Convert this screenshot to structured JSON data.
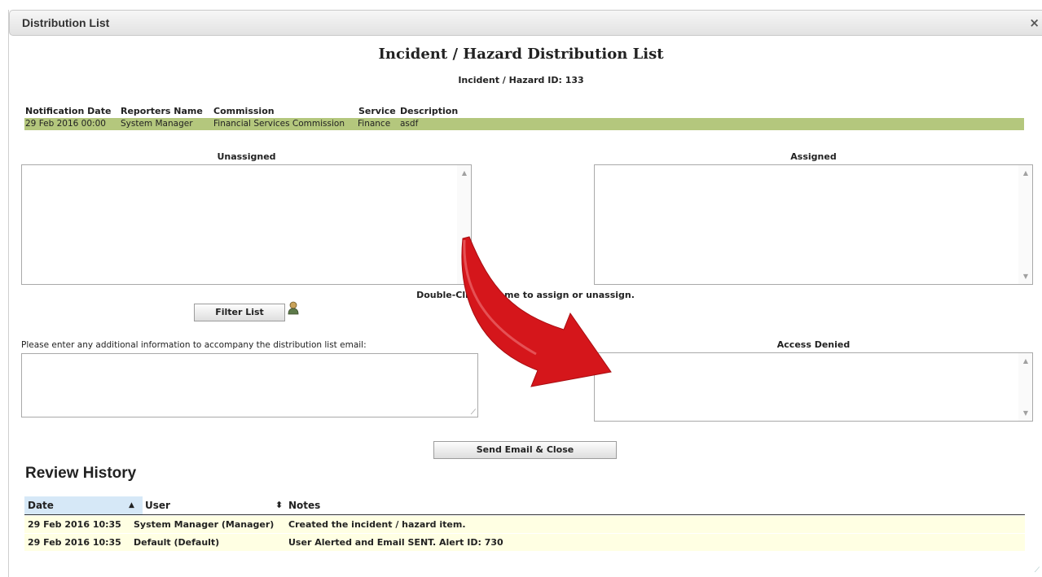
{
  "dialog": {
    "title": "Distribution List",
    "close_icon": "×"
  },
  "header": {
    "title": "Incident / Hazard Distribution List",
    "id_line": "Incident / Hazard ID: 133"
  },
  "info": {
    "columns": [
      "Notification Date",
      "Reporters Name",
      "Commission",
      "Service",
      "Description"
    ],
    "row": [
      "29 Feb 2016 00:00",
      "System Manager",
      "Financial Services Commission",
      "Finance",
      "asdf"
    ],
    "row_color": "#b4c77d"
  },
  "lists": {
    "unassigned_label": "Unassigned",
    "assigned_label": "Assigned",
    "hint": "Double-Click a name to assign or unassign.",
    "filter_button": "Filter List",
    "additional_info_label": "Please enter any additional information to accompany the distribution list email:",
    "access_denied_label": "Access Denied",
    "send_button": "Send Email & Close"
  },
  "review": {
    "title": "Review History",
    "columns": [
      "Date",
      "User",
      "Notes"
    ],
    "sort_up_icon": "▲",
    "sort_both_icon": "⬍",
    "rows": [
      {
        "date": "29 Feb 2016 10:35",
        "user": "System Manager (Manager)",
        "notes": "Created the incident / hazard item."
      },
      {
        "date": "29 Feb 2016 10:35",
        "user": "Default (Default)",
        "notes": "User Alerted and Email SENT. Alert ID: 730"
      }
    ]
  },
  "colors": {
    "accent_arrow": "#d5161b",
    "row_highlight": "#ffffe3",
    "sorted_header": "#d6e8f7"
  }
}
